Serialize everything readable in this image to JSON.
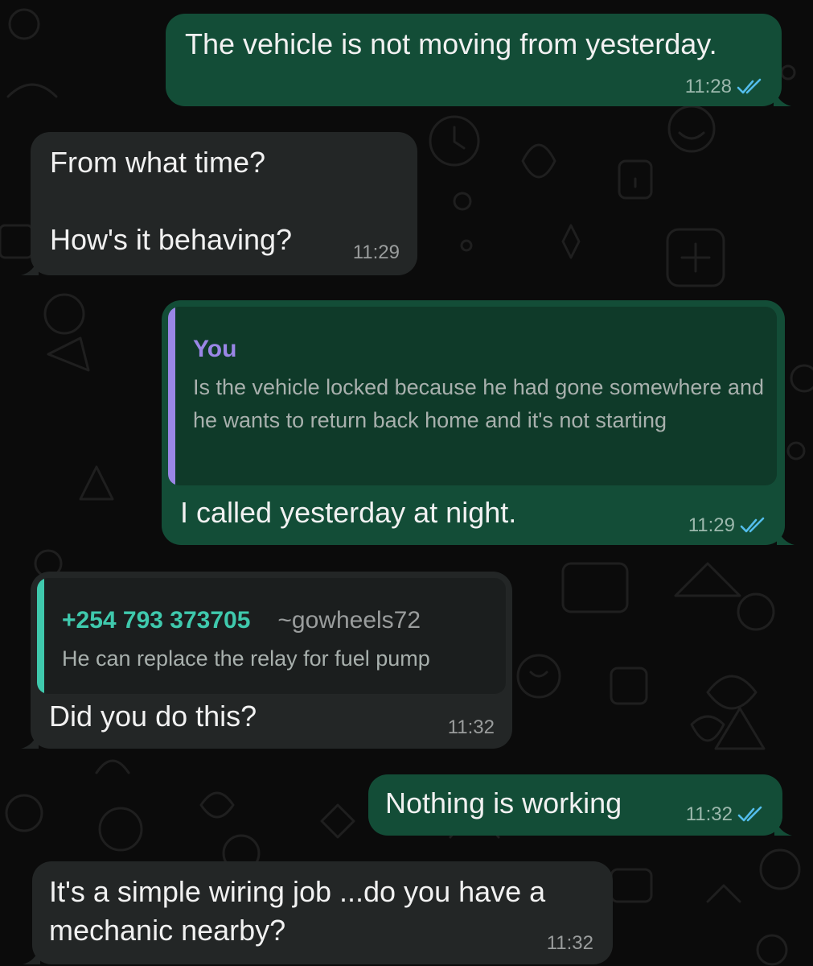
{
  "messages": [
    {
      "id": "m1",
      "direction": "outgoing",
      "text": "The vehicle is not moving from yesterday.",
      "time": "11:28",
      "status_icon": "double-check-read-icon"
    },
    {
      "id": "m2",
      "direction": "incoming",
      "text": "From what time?\n\nHow's it behaving?",
      "time": "11:29"
    },
    {
      "id": "m3",
      "direction": "outgoing",
      "quote": {
        "author": "You",
        "text": "Is the vehicle locked because he had gone somewhere and he wants to return back home and it's not starting"
      },
      "text": "I called yesterday at night.",
      "time": "11:29",
      "status_icon": "double-check-read-icon"
    },
    {
      "id": "m4",
      "direction": "incoming",
      "quote": {
        "author": "+254 793 373705",
        "author_name": "~gowheels72",
        "text": "He can replace the relay for fuel  pump"
      },
      "text": "Did you do this?",
      "time": "11:32"
    },
    {
      "id": "m5",
      "direction": "outgoing",
      "text": "Nothing is working",
      "time": "11:32",
      "status_icon": "double-check-read-icon"
    },
    {
      "id": "m6",
      "direction": "incoming",
      "text": "It's a simple wiring job ...do you have a mechanic nearby?",
      "time": "11:32"
    }
  ],
  "colors": {
    "background": "#0b0b0b",
    "outgoing_bubble": "#134d37",
    "incoming_bubble": "#232626",
    "outgoing_quote_bg": "#0f3a29",
    "incoming_quote_bg": "#1b1e1e",
    "self_quote_accent": "#9a86e6",
    "member_quote_accent": "#3fc9ad",
    "read_tick": "#53bdeb"
  }
}
